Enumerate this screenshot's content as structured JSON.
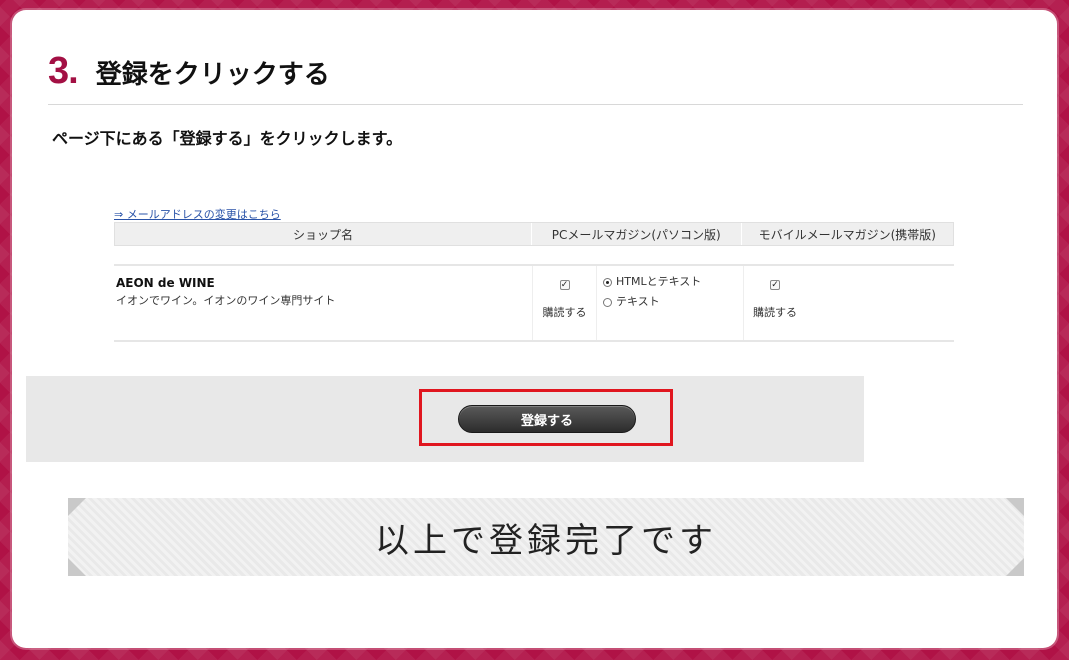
{
  "step": {
    "number": "3.",
    "title": "登録をクリックする",
    "instruction": "ページ下にある「登録する」をクリックします。"
  },
  "screenshot": {
    "change_email_link": "⇒ メールアドレスの変更はこちら",
    "headers": {
      "shop": "ショップ名",
      "pc": "PCメールマガジン(パソコン版)",
      "mobile": "モバイルメールマガジン(携帯版)"
    },
    "row": {
      "shop_name": "AEON de WINE",
      "shop_desc": "イオンでワイン。イオンのワイン専門サイト",
      "pc_subscribe_label": "購読する",
      "format_options": [
        "HTMLとテキスト",
        "テキスト"
      ],
      "mobile_subscribe_label": "購読する"
    },
    "submit_label": "登録する"
  },
  "completion_text": "以上で登録完了です",
  "colors": {
    "accent": "#a31044",
    "highlight": "#e0161f",
    "frame": "#b01246"
  }
}
